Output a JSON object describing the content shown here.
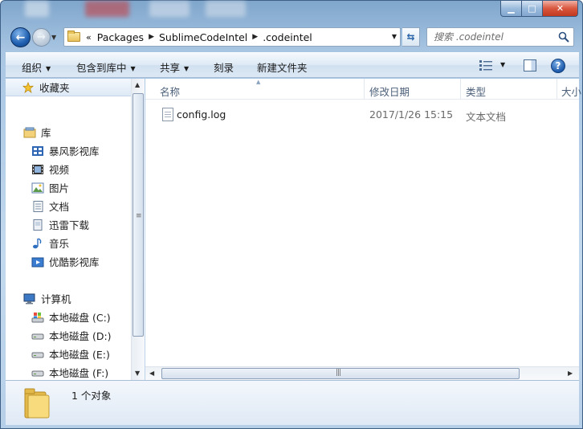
{
  "window": {
    "caption_buttons": {
      "minimize": "▁",
      "maximize": "□",
      "close": "✕"
    }
  },
  "address": {
    "overflow": "«",
    "breadcrumbs": [
      "Packages",
      "SublimeCodeIntel",
      ".codeintel"
    ]
  },
  "search": {
    "placeholder": "搜索 .codeintel"
  },
  "toolbar": {
    "organize": "组织",
    "include_in_library": "包含到库中",
    "share": "共享",
    "burn": "刻录",
    "new_folder": "新建文件夹"
  },
  "sidebar": {
    "favorites": "收藏夹",
    "libraries": "库",
    "library_items": [
      "暴风影视库",
      "视频",
      "图片",
      "文档",
      "迅雷下载",
      "音乐",
      "优酷影视库"
    ],
    "computer": "计算机",
    "drives": [
      "本地磁盘 (C:)",
      "本地磁盘 (D:)",
      "本地磁盘 (E:)",
      "本地磁盘 (F:)"
    ]
  },
  "columns": {
    "name": "名称",
    "modified": "修改日期",
    "type": "类型",
    "size": "大小"
  },
  "files": [
    {
      "name": "config.log",
      "modified": "2017/1/26 15:15",
      "type": "文本文档"
    }
  ],
  "status": {
    "count_text": "1 个对象"
  },
  "colors": {
    "accent": "#1f5fb0",
    "chrome": "#c3d9ee",
    "close": "#c0391f"
  }
}
